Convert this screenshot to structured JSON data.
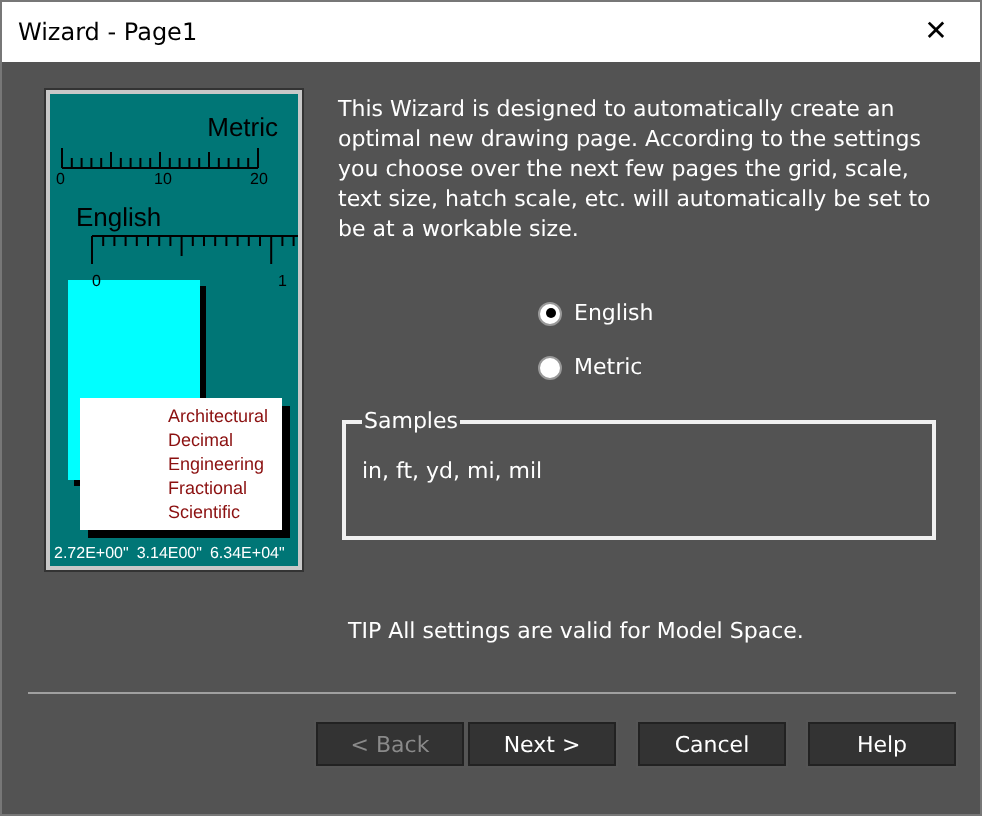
{
  "window": {
    "title": "Wizard - Page1",
    "close": "✕"
  },
  "illustration": {
    "metric_label": "Metric",
    "metric_ticks": [
      "0",
      "10",
      "20"
    ],
    "english_label": "English",
    "english_ticks": [
      "0",
      "1"
    ],
    "formats": [
      "Architectural",
      "Decimal",
      "Engineering",
      "Fractional",
      "Scientific"
    ],
    "samples": [
      "2.72E+00\"",
      "3.14E00\"",
      "6.34E+04\""
    ]
  },
  "description": "This Wizard is designed to automatically create an optimal new drawing page. According to the settings you choose over the next few pages the grid, scale, text size, hatch scale, etc. will automatically be set to be at a workable size.",
  "units": [
    {
      "label": "English",
      "selected": true
    },
    {
      "label": "Metric",
      "selected": false
    }
  ],
  "samples": {
    "title": "Samples",
    "text": "in, ft, yd, mi, mil"
  },
  "tip": "TIP  All settings are valid for Model Space.",
  "buttons": [
    {
      "label": "< Back",
      "disabled": true
    },
    {
      "label": "Next >",
      "disabled": false
    },
    {
      "label": "Cancel",
      "disabled": false
    },
    {
      "label": "Help",
      "disabled": false
    }
  ]
}
